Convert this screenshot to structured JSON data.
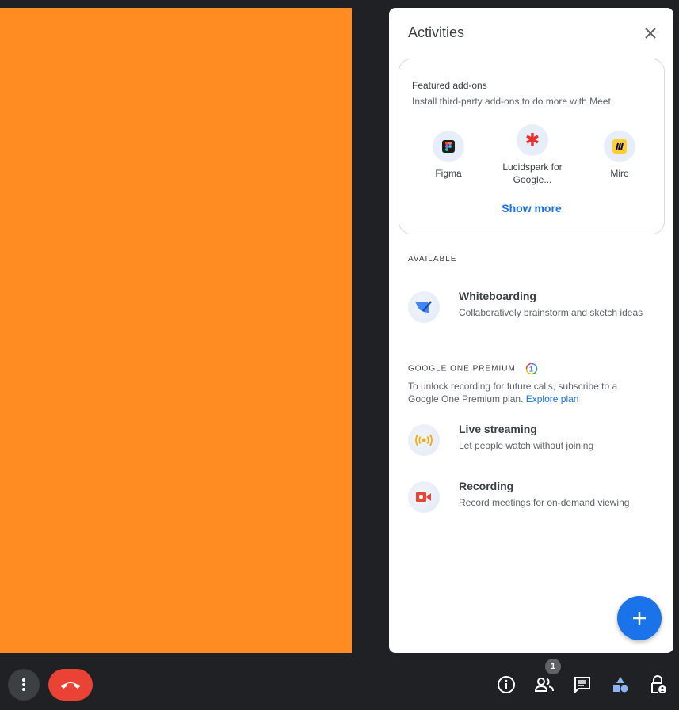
{
  "panel": {
    "title": "Activities",
    "featured": {
      "title": "Featured add-ons",
      "subtitle": "Install third-party add-ons to do more with Meet",
      "addons": [
        {
          "label": "Figma",
          "icon": "figma-icon"
        },
        {
          "label": "Lucidspark for Google...",
          "icon": "lucidspark-icon"
        },
        {
          "label": "Miro",
          "icon": "miro-icon"
        }
      ],
      "show_more": "Show more"
    },
    "available": {
      "label": "AVAILABLE",
      "items": [
        {
          "title": "Whiteboarding",
          "desc": "Collaboratively brainstorm and sketch ideas",
          "icon": "whiteboard-icon"
        }
      ]
    },
    "premium": {
      "label": "GOOGLE ONE PREMIUM",
      "text": "To unlock recording for future calls, subscribe to a Google One Premium plan.",
      "link": "Explore plan",
      "items": [
        {
          "title": "Live streaming",
          "desc": "Let people watch without joining",
          "icon": "live-stream-icon"
        },
        {
          "title": "Recording",
          "desc": "Record meetings for on-demand viewing",
          "icon": "recording-icon"
        }
      ]
    }
  },
  "toolbar": {
    "participants_count": "1"
  },
  "colors": {
    "video_tile": "#fe8c22",
    "accent": "#1a73e8",
    "hangup": "#ea4335",
    "background": "#202124"
  }
}
